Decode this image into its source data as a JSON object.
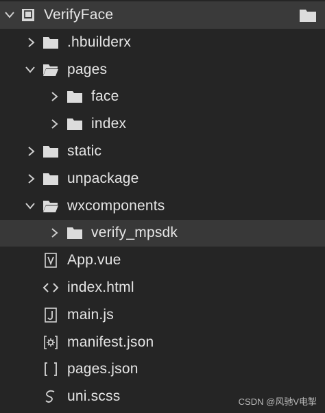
{
  "explorer": {
    "root": {
      "label": "VerifyFace",
      "expanded": true,
      "icon": "project-icon"
    },
    "items": [
      {
        "label": ".hbuilderx",
        "type": "folder",
        "expanded": false,
        "depth": 1
      },
      {
        "label": "pages",
        "type": "folder",
        "expanded": true,
        "depth": 1
      },
      {
        "label": "face",
        "type": "folder",
        "expanded": false,
        "depth": 2
      },
      {
        "label": "index",
        "type": "folder",
        "expanded": false,
        "depth": 2
      },
      {
        "label": "static",
        "type": "folder",
        "expanded": false,
        "depth": 1
      },
      {
        "label": "unpackage",
        "type": "folder",
        "expanded": false,
        "depth": 1
      },
      {
        "label": "wxcomponents",
        "type": "folder",
        "expanded": true,
        "depth": 1
      },
      {
        "label": "verify_mpsdk",
        "type": "folder",
        "expanded": false,
        "depth": 2,
        "selected": true
      },
      {
        "label": "App.vue",
        "type": "file",
        "icon": "vue-file-icon",
        "depth": 1
      },
      {
        "label": "index.html",
        "type": "file",
        "icon": "html-file-icon",
        "depth": 1
      },
      {
        "label": "main.js",
        "type": "file",
        "icon": "js-file-icon",
        "depth": 1
      },
      {
        "label": "manifest.json",
        "type": "file",
        "icon": "manifest-file-icon",
        "depth": 1
      },
      {
        "label": "pages.json",
        "type": "file",
        "icon": "json-file-icon",
        "depth": 1
      },
      {
        "label": "uni.scss",
        "type": "file",
        "icon": "scss-file-icon",
        "depth": 1
      }
    ]
  },
  "watermark": "CSDN @风驰V电掣",
  "colors": {
    "background": "#252525",
    "root_row": "#3a3a3a",
    "selected_row": "#383838",
    "text": "#e6e6e6"
  }
}
